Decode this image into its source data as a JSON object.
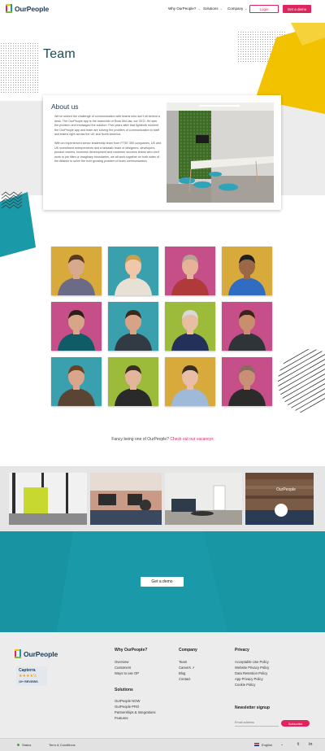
{
  "header": {
    "brand": "OurPeople",
    "nav": [
      {
        "label": "Why OurPeople?"
      },
      {
        "label": "Solutions"
      },
      {
        "label": "Company"
      }
    ],
    "login_label": "Login",
    "demo_label": "Get a demo"
  },
  "hero": {
    "title": "Team"
  },
  "about": {
    "title": "About us",
    "paragraphs": [
      "We've solved the challenge of communication with teams who don't sit behind a desk. The OurPeople app is the brainchild of Ross McCaw, our CEO. He saw the problem and envisaged the solution. Five years after that lightbulb moment the OurPeople app and team are solving the problem of communication to staff and teams right across the UK and North America.",
      "With an experienced senior leadership team from FTSE 350 companies, US and UK investment entrepreneurs and a fantastic team of designers, developers, product owners, business development and customer success teams who don't work to job titles or imaginary boundaries, we all work together on both sides of the Atlantic to solve the ever growing problem of team communication."
    ]
  },
  "team": {
    "members": [
      {
        "bg": "#d8a93b",
        "shirt": "#6b6b86",
        "skin": "#d9a98c",
        "hair": "#5a3a22"
      },
      {
        "bg": "#3aa0ad",
        "shirt": "#e7e0d4",
        "skin": "#f0c7a8",
        "hair": "#c9a04c"
      },
      {
        "bg": "#c64f8a",
        "shirt": "#b03a3a",
        "skin": "#e6b398",
        "hair": "#b7a08f"
      },
      {
        "bg": "#d8a93b",
        "shirt": "#2f6cc2",
        "skin": "#9a6846",
        "hair": "#1f1f1f"
      },
      {
        "bg": "#c64f8a",
        "shirt": "#0f5c66",
        "skin": "#d8a589",
        "hair": "#2a2018"
      },
      {
        "bg": "#3aa0ad",
        "shirt": "#323b44",
        "skin": "#d6a386",
        "hair": "#3a2a1c"
      },
      {
        "bg": "#9dbb3a",
        "shirt": "#23305a",
        "skin": "#e7bda4",
        "hair": "#d9d9d9"
      },
      {
        "bg": "#c64f8a",
        "shirt": "#2e3437",
        "skin": "#c98e6e",
        "hair": "#3a2416"
      },
      {
        "bg": "#3aa0ad",
        "shirt": "#5a4535",
        "skin": "#d9a68b",
        "hair": "#6a3f22"
      },
      {
        "bg": "#9dbb3a",
        "shirt": "#2a2a2a",
        "skin": "#e3b59b",
        "hair": "#3b2c22"
      },
      {
        "bg": "#d8a93b",
        "shirt": "#9fb9d9",
        "skin": "#e8bea6",
        "hair": "#3a2a1f"
      },
      {
        "bg": "#c64f8a",
        "shirt": "#2b2b2b",
        "skin": "#c99077",
        "hair": "#8a6a5a"
      }
    ]
  },
  "vacancy": {
    "prefix": "Fancy being one of OurPeople?",
    "link": "Check out our vacancys"
  },
  "cta": {
    "button": "Get a demo"
  },
  "footer": {
    "brand": "OurPeople",
    "capterra": {
      "brand": "Capterra",
      "rating": "★★★★½",
      "reviews": "10+ REVIEWS"
    },
    "why": {
      "title": "Why OurPeople?",
      "links": [
        "Overview",
        "Customers",
        "Ways to use OP"
      ]
    },
    "solutions": {
      "title": "Solutions",
      "links": [
        "OurPeople NOW",
        "OurPeople PRO",
        "Partnerships & Integrations",
        "Features"
      ]
    },
    "company": {
      "title": "Company",
      "links": [
        "Team",
        "Careers",
        "Blog",
        "Contact"
      ]
    },
    "privacy": {
      "title": "Privacy",
      "links": [
        "Acceptable Use Policy",
        "Website Privacy Policy",
        "Data Retention Policy",
        "App Privacy Policy",
        "Cookie Policy"
      ]
    },
    "newsletter": {
      "title": "Newsletter signup",
      "placeholder": "Email address",
      "button": "Subscribe"
    }
  },
  "bottombar": {
    "status": "Status",
    "terms": "Term & Conditions",
    "language": "English"
  },
  "colors": {
    "accent": "#e0245e",
    "teal": "#1a9aa8",
    "navy": "#1d3a58",
    "yellow": "#f2c200"
  }
}
